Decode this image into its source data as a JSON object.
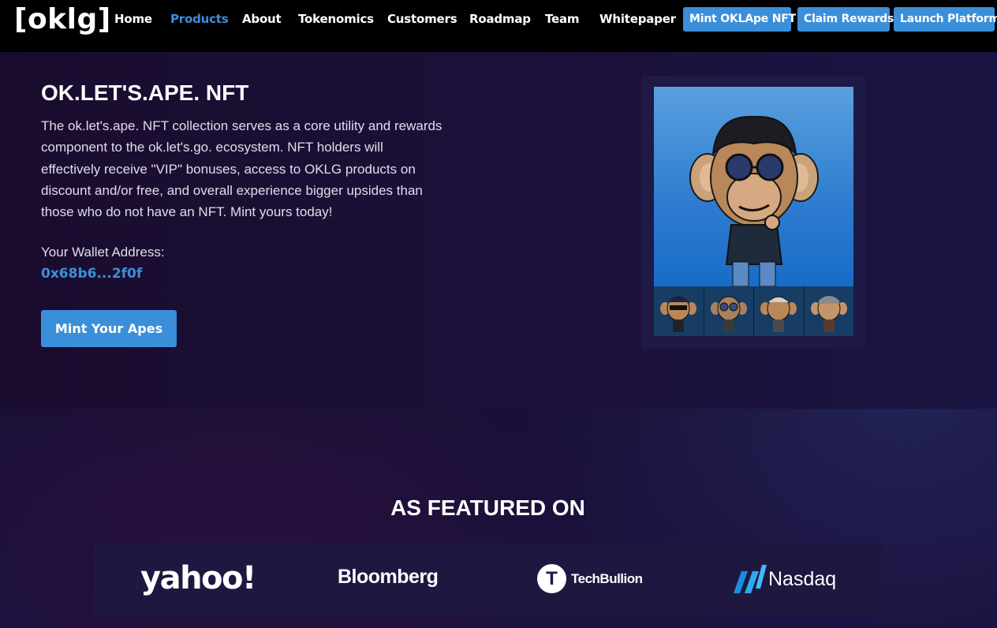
{
  "nav": {
    "logo": "[oklg]",
    "links": [
      "Home",
      "Products",
      "About",
      "Tokenomics",
      "Customers",
      "Roadmap",
      "Team",
      "Whitepaper"
    ],
    "active_link": "Products",
    "buttons": [
      "Mint OKLApe NFT",
      "Claim Rewards",
      "Launch Platform"
    ]
  },
  "hero": {
    "title": "OK.LET'S.APE. NFT",
    "description": "The ok.let's.ape. NFT collection serves as a core utility and rewards component to the ok.let's.go. ecosystem. NFT holders will effectively receive \"VIP\" bonuses, access to OKLG products on discount and/or free, and overall experience bigger upsides than those who do not have an NFT. Mint yours today!",
    "wallet_label": "Your Wallet Address:",
    "wallet_address": "0x68b6...2f0f",
    "mint_button": "Mint Your Apes"
  },
  "nft": {
    "main_icon": "ape-nft-image",
    "thumbnails": [
      "ape-thumbnail-1",
      "ape-thumbnail-2",
      "ape-thumbnail-3",
      "ape-thumbnail-4"
    ]
  },
  "featured": {
    "title": "AS FEATURED ON",
    "logos": {
      "yahoo": "yahoo!",
      "bloomberg": "Bloomberg",
      "techbullion_letter": "T",
      "techbullion": "TechBullion",
      "nasdaq": "Nasdaq"
    }
  },
  "colors": {
    "accent": "#3b8fd9",
    "nav_bg": "#000000",
    "page_bg": "#1a0f33"
  }
}
